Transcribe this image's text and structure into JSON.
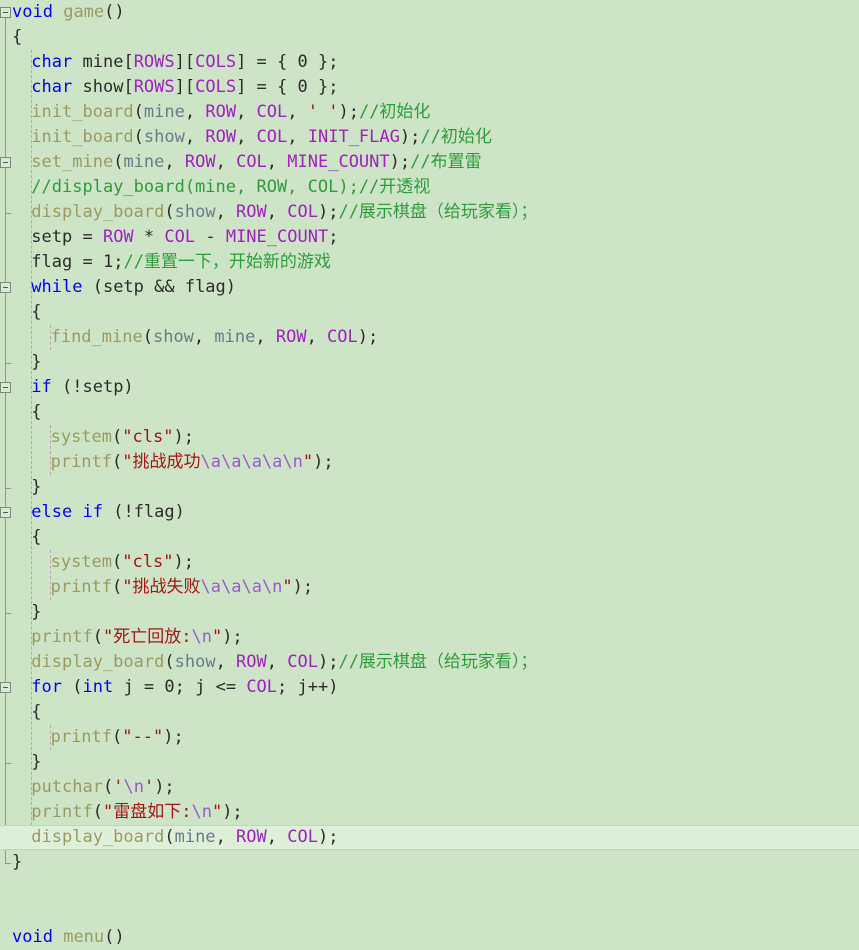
{
  "editor": {
    "app": "visual-studio-code-editor",
    "background_color": "#cde5c6",
    "current_line_background": "#dff0da",
    "font_size_px": 17,
    "line_height_px": 25,
    "colors": {
      "keyword": "#0000ff",
      "macro": "#a020c0",
      "function": "#9a9a62",
      "variable": "#6a7a8a",
      "string": "#a31515",
      "escape": "#9b59d0",
      "comment": "#2e9b3c",
      "plain": "#2b2b2b",
      "fold_marker_border": "#7d8a7c",
      "indent_guide": "#b9a6ab"
    }
  },
  "lines": [
    {
      "n": 1,
      "indent": 0,
      "fold": "open",
      "current": false,
      "tokens": [
        {
          "t": "void",
          "c": "kw"
        },
        {
          "t": " ",
          "c": "pln"
        },
        {
          "t": "game",
          "c": "fn"
        },
        {
          "t": "()",
          "c": "pln"
        }
      ]
    },
    {
      "n": 2,
      "indent": 0,
      "fold": "none",
      "current": false,
      "tokens": [
        {
          "t": "{",
          "c": "pln"
        }
      ]
    },
    {
      "n": 3,
      "indent": 1,
      "fold": "none",
      "current": false,
      "tokens": [
        {
          "t": "char",
          "c": "kw"
        },
        {
          "t": " mine",
          "c": "pln"
        },
        {
          "t": "[",
          "c": "pln"
        },
        {
          "t": "ROWS",
          "c": "mac"
        },
        {
          "t": "][",
          "c": "pln"
        },
        {
          "t": "COLS",
          "c": "mac"
        },
        {
          "t": "] = { ",
          "c": "pln"
        },
        {
          "t": "0",
          "c": "num"
        },
        {
          "t": " };",
          "c": "pln"
        }
      ]
    },
    {
      "n": 4,
      "indent": 1,
      "fold": "none",
      "current": false,
      "tokens": [
        {
          "t": "char",
          "c": "kw"
        },
        {
          "t": " show",
          "c": "pln"
        },
        {
          "t": "[",
          "c": "pln"
        },
        {
          "t": "ROWS",
          "c": "mac"
        },
        {
          "t": "][",
          "c": "pln"
        },
        {
          "t": "COLS",
          "c": "mac"
        },
        {
          "t": "] = { ",
          "c": "pln"
        },
        {
          "t": "0",
          "c": "num"
        },
        {
          "t": " };",
          "c": "pln"
        }
      ]
    },
    {
      "n": 5,
      "indent": 1,
      "fold": "none",
      "current": false,
      "tokens": [
        {
          "t": "init_board",
          "c": "fn"
        },
        {
          "t": "(",
          "c": "pln"
        },
        {
          "t": "mine",
          "c": "var"
        },
        {
          "t": ", ",
          "c": "pln"
        },
        {
          "t": "ROW",
          "c": "mac"
        },
        {
          "t": ", ",
          "c": "pln"
        },
        {
          "t": "COL",
          "c": "mac"
        },
        {
          "t": ", ",
          "c": "pln"
        },
        {
          "t": "' '",
          "c": "str"
        },
        {
          "t": ");",
          "c": "pln"
        },
        {
          "t": "//初始化",
          "c": "cmt"
        }
      ]
    },
    {
      "n": 6,
      "indent": 1,
      "fold": "none",
      "current": false,
      "tokens": [
        {
          "t": "init_board",
          "c": "fn"
        },
        {
          "t": "(",
          "c": "pln"
        },
        {
          "t": "show",
          "c": "var"
        },
        {
          "t": ", ",
          "c": "pln"
        },
        {
          "t": "ROW",
          "c": "mac"
        },
        {
          "t": ", ",
          "c": "pln"
        },
        {
          "t": "COL",
          "c": "mac"
        },
        {
          "t": ", ",
          "c": "pln"
        },
        {
          "t": "INIT_FLAG",
          "c": "mac"
        },
        {
          "t": ");",
          "c": "pln"
        },
        {
          "t": "//初始化",
          "c": "cmt"
        }
      ]
    },
    {
      "n": 7,
      "indent": 1,
      "fold": "open",
      "current": false,
      "tokens": [
        {
          "t": "set_mine",
          "c": "fn"
        },
        {
          "t": "(",
          "c": "pln"
        },
        {
          "t": "mine",
          "c": "var"
        },
        {
          "t": ", ",
          "c": "pln"
        },
        {
          "t": "ROW",
          "c": "mac"
        },
        {
          "t": ", ",
          "c": "pln"
        },
        {
          "t": "COL",
          "c": "mac"
        },
        {
          "t": ", ",
          "c": "pln"
        },
        {
          "t": "MINE_COUNT",
          "c": "mac"
        },
        {
          "t": ");",
          "c": "pln"
        },
        {
          "t": "//布置雷",
          "c": "cmt"
        }
      ]
    },
    {
      "n": 8,
      "indent": 1,
      "fold": "none",
      "current": false,
      "tokens": [
        {
          "t": "//display_board(mine, ROW, COL);//开透视",
          "c": "cmt"
        }
      ]
    },
    {
      "n": 9,
      "indent": 1,
      "fold": "endtick",
      "current": false,
      "tokens": [
        {
          "t": "display_board",
          "c": "fn"
        },
        {
          "t": "(",
          "c": "pln"
        },
        {
          "t": "show",
          "c": "var"
        },
        {
          "t": ", ",
          "c": "pln"
        },
        {
          "t": "ROW",
          "c": "mac"
        },
        {
          "t": ", ",
          "c": "pln"
        },
        {
          "t": "COL",
          "c": "mac"
        },
        {
          "t": ");",
          "c": "pln"
        },
        {
          "t": "//展示棋盘（给玩家看）；",
          "c": "cmt"
        }
      ]
    },
    {
      "n": 10,
      "indent": 1,
      "fold": "none",
      "current": false,
      "tokens": [
        {
          "t": "setp = ",
          "c": "pln"
        },
        {
          "t": "ROW",
          "c": "mac"
        },
        {
          "t": " * ",
          "c": "pln"
        },
        {
          "t": "COL",
          "c": "mac"
        },
        {
          "t": " - ",
          "c": "pln"
        },
        {
          "t": "MINE_COUNT",
          "c": "mac"
        },
        {
          "t": ";",
          "c": "pln"
        }
      ]
    },
    {
      "n": 11,
      "indent": 1,
      "fold": "none",
      "current": false,
      "tokens": [
        {
          "t": "flag = ",
          "c": "pln"
        },
        {
          "t": "1",
          "c": "num"
        },
        {
          "t": ";",
          "c": "pln"
        },
        {
          "t": "//重置一下，开始新的游戏",
          "c": "cmt"
        }
      ]
    },
    {
      "n": 12,
      "indent": 1,
      "fold": "open",
      "current": false,
      "tokens": [
        {
          "t": "while",
          "c": "kw"
        },
        {
          "t": " (setp && flag)",
          "c": "pln"
        }
      ]
    },
    {
      "n": 13,
      "indent": 1,
      "fold": "none",
      "current": false,
      "tokens": [
        {
          "t": "{",
          "c": "pln"
        }
      ]
    },
    {
      "n": 14,
      "indent": 2,
      "fold": "none",
      "current": false,
      "tokens": [
        {
          "t": "find_mine",
          "c": "fn"
        },
        {
          "t": "(",
          "c": "pln"
        },
        {
          "t": "show",
          "c": "var"
        },
        {
          "t": ", ",
          "c": "pln"
        },
        {
          "t": "mine",
          "c": "var"
        },
        {
          "t": ", ",
          "c": "pln"
        },
        {
          "t": "ROW",
          "c": "mac"
        },
        {
          "t": ", ",
          "c": "pln"
        },
        {
          "t": "COL",
          "c": "mac"
        },
        {
          "t": ");",
          "c": "pln"
        }
      ]
    },
    {
      "n": 15,
      "indent": 1,
      "fold": "endtick",
      "current": false,
      "tokens": [
        {
          "t": "}",
          "c": "pln"
        }
      ]
    },
    {
      "n": 16,
      "indent": 1,
      "fold": "open",
      "current": false,
      "tokens": [
        {
          "t": "if",
          "c": "kw"
        },
        {
          "t": " (!setp)",
          "c": "pln"
        }
      ]
    },
    {
      "n": 17,
      "indent": 1,
      "fold": "none",
      "current": false,
      "tokens": [
        {
          "t": "{",
          "c": "pln"
        }
      ]
    },
    {
      "n": 18,
      "indent": 2,
      "fold": "none",
      "current": false,
      "tokens": [
        {
          "t": "system",
          "c": "fn"
        },
        {
          "t": "(",
          "c": "pln"
        },
        {
          "t": "\"cls\"",
          "c": "str"
        },
        {
          "t": ");",
          "c": "pln"
        }
      ]
    },
    {
      "n": 19,
      "indent": 2,
      "fold": "none",
      "current": false,
      "tokens": [
        {
          "t": "printf",
          "c": "fn"
        },
        {
          "t": "(",
          "c": "pln"
        },
        {
          "t": "\"挑战成功",
          "c": "str"
        },
        {
          "t": "\\a\\a\\a\\a\\n",
          "c": "esc"
        },
        {
          "t": "\"",
          "c": "str"
        },
        {
          "t": ");",
          "c": "pln"
        }
      ]
    },
    {
      "n": 20,
      "indent": 1,
      "fold": "endtick",
      "current": false,
      "tokens": [
        {
          "t": "}",
          "c": "pln"
        }
      ]
    },
    {
      "n": 21,
      "indent": 1,
      "fold": "open",
      "current": false,
      "tokens": [
        {
          "t": "else",
          "c": "kw"
        },
        {
          "t": " ",
          "c": "pln"
        },
        {
          "t": "if",
          "c": "kw"
        },
        {
          "t": " (!flag)",
          "c": "pln"
        }
      ]
    },
    {
      "n": 22,
      "indent": 1,
      "fold": "none",
      "current": false,
      "tokens": [
        {
          "t": "{",
          "c": "pln"
        }
      ]
    },
    {
      "n": 23,
      "indent": 2,
      "fold": "none",
      "current": false,
      "tokens": [
        {
          "t": "system",
          "c": "fn"
        },
        {
          "t": "(",
          "c": "pln"
        },
        {
          "t": "\"cls\"",
          "c": "str"
        },
        {
          "t": ");",
          "c": "pln"
        }
      ]
    },
    {
      "n": 24,
      "indent": 2,
      "fold": "none",
      "current": false,
      "tokens": [
        {
          "t": "printf",
          "c": "fn"
        },
        {
          "t": "(",
          "c": "pln"
        },
        {
          "t": "\"挑战失败",
          "c": "str"
        },
        {
          "t": "\\a\\a\\a\\n",
          "c": "esc"
        },
        {
          "t": "\"",
          "c": "str"
        },
        {
          "t": ");",
          "c": "pln"
        }
      ]
    },
    {
      "n": 25,
      "indent": 1,
      "fold": "endtick",
      "current": false,
      "tokens": [
        {
          "t": "}",
          "c": "pln"
        }
      ]
    },
    {
      "n": 26,
      "indent": 1,
      "fold": "none",
      "current": false,
      "tokens": [
        {
          "t": "printf",
          "c": "fn"
        },
        {
          "t": "(",
          "c": "pln"
        },
        {
          "t": "\"死亡回放:",
          "c": "str"
        },
        {
          "t": "\\n",
          "c": "esc"
        },
        {
          "t": "\"",
          "c": "str"
        },
        {
          "t": ");",
          "c": "pln"
        }
      ]
    },
    {
      "n": 27,
      "indent": 1,
      "fold": "none",
      "current": false,
      "tokens": [
        {
          "t": "display_board",
          "c": "fn"
        },
        {
          "t": "(",
          "c": "pln"
        },
        {
          "t": "show",
          "c": "var"
        },
        {
          "t": ", ",
          "c": "pln"
        },
        {
          "t": "ROW",
          "c": "mac"
        },
        {
          "t": ", ",
          "c": "pln"
        },
        {
          "t": "COL",
          "c": "mac"
        },
        {
          "t": ");",
          "c": "pln"
        },
        {
          "t": "//展示棋盘（给玩家看）；",
          "c": "cmt"
        }
      ]
    },
    {
      "n": 28,
      "indent": 1,
      "fold": "open",
      "current": false,
      "tokens": [
        {
          "t": "for",
          "c": "kw"
        },
        {
          "t": " (",
          "c": "pln"
        },
        {
          "t": "int",
          "c": "kw"
        },
        {
          "t": " j = ",
          "c": "pln"
        },
        {
          "t": "0",
          "c": "num"
        },
        {
          "t": "; j <= ",
          "c": "pln"
        },
        {
          "t": "COL",
          "c": "mac"
        },
        {
          "t": "; j++)",
          "c": "pln"
        }
      ]
    },
    {
      "n": 29,
      "indent": 1,
      "fold": "none",
      "current": false,
      "tokens": [
        {
          "t": "{",
          "c": "pln"
        }
      ]
    },
    {
      "n": 30,
      "indent": 2,
      "fold": "none",
      "current": false,
      "tokens": [
        {
          "t": "printf",
          "c": "fn"
        },
        {
          "t": "(",
          "c": "pln"
        },
        {
          "t": "\"--\"",
          "c": "str"
        },
        {
          "t": ");",
          "c": "pln"
        }
      ]
    },
    {
      "n": 31,
      "indent": 1,
      "fold": "endtick",
      "current": false,
      "tokens": [
        {
          "t": "}",
          "c": "pln"
        }
      ]
    },
    {
      "n": 32,
      "indent": 1,
      "fold": "none",
      "current": false,
      "tokens": [
        {
          "t": "putchar",
          "c": "fn"
        },
        {
          "t": "(",
          "c": "pln"
        },
        {
          "t": "'",
          "c": "str"
        },
        {
          "t": "\\n",
          "c": "esc"
        },
        {
          "t": "'",
          "c": "str"
        },
        {
          "t": ");",
          "c": "pln"
        }
      ]
    },
    {
      "n": 33,
      "indent": 1,
      "fold": "none",
      "current": false,
      "tokens": [
        {
          "t": "printf",
          "c": "fn"
        },
        {
          "t": "(",
          "c": "pln"
        },
        {
          "t": "\"雷盘如下:",
          "c": "str"
        },
        {
          "t": "\\n",
          "c": "esc"
        },
        {
          "t": "\"",
          "c": "str"
        },
        {
          "t": ");",
          "c": "pln"
        }
      ]
    },
    {
      "n": 34,
      "indent": 1,
      "fold": "none",
      "current": true,
      "tokens": [
        {
          "t": "display_board",
          "c": "fn"
        },
        {
          "t": "(",
          "c": "pln"
        },
        {
          "t": "mine",
          "c": "var"
        },
        {
          "t": ", ",
          "c": "pln"
        },
        {
          "t": "ROW",
          "c": "mac"
        },
        {
          "t": ", ",
          "c": "pln"
        },
        {
          "t": "COL",
          "c": "mac"
        },
        {
          "t": ");",
          "c": "pln"
        }
      ]
    },
    {
      "n": 35,
      "indent": 0,
      "fold": "endtick",
      "current": false,
      "tokens": [
        {
          "t": "}",
          "c": "pln"
        }
      ]
    },
    {
      "n": 36,
      "indent": 0,
      "fold": "none",
      "current": false,
      "tokens": []
    },
    {
      "n": 37,
      "indent": 0,
      "fold": "none",
      "current": false,
      "tokens": []
    },
    {
      "n": 38,
      "indent": 0,
      "fold": "none",
      "current": false,
      "tokens": [
        {
          "t": "void",
          "c": "kw"
        },
        {
          "t": " ",
          "c": "pln"
        },
        {
          "t": "menu",
          "c": "fn"
        },
        {
          "t": "()",
          "c": "pln"
        }
      ]
    }
  ],
  "fold_margin": {
    "name": "outlining-margin",
    "markers": [
      {
        "line": 1,
        "type": "collapse-box"
      },
      {
        "line": 7,
        "type": "collapse-box"
      },
      {
        "line": 9,
        "type": "region-end-tick"
      },
      {
        "line": 12,
        "type": "collapse-box"
      },
      {
        "line": 15,
        "type": "region-end-tick"
      },
      {
        "line": 16,
        "type": "collapse-box"
      },
      {
        "line": 20,
        "type": "region-end-tick"
      },
      {
        "line": 21,
        "type": "collapse-box"
      },
      {
        "line": 25,
        "type": "region-end-tick"
      },
      {
        "line": 28,
        "type": "collapse-box"
      },
      {
        "line": 31,
        "type": "region-end-tick"
      },
      {
        "line": 35,
        "type": "region-end-tick"
      }
    ]
  },
  "indent_guides": [
    {
      "from_line": 3,
      "to_line": 34,
      "col": 1
    },
    {
      "from_line": 14,
      "to_line": 14,
      "col": 2
    },
    {
      "from_line": 18,
      "to_line": 19,
      "col": 2
    },
    {
      "from_line": 23,
      "to_line": 24,
      "col": 2
    },
    {
      "from_line": 30,
      "to_line": 30,
      "col": 2
    }
  ]
}
